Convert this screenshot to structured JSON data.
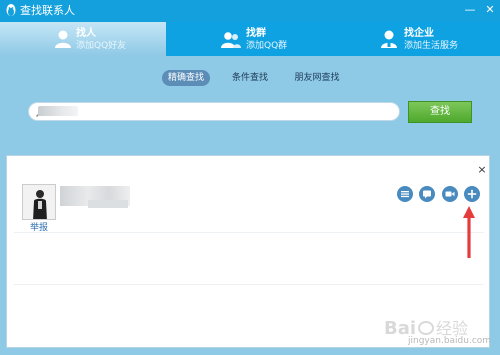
{
  "window": {
    "title": "查找联系人",
    "minimize_glyph": "—",
    "close_glyph": "✕"
  },
  "tabs": [
    {
      "label": "找人",
      "sublabel": "添加QQ好友",
      "icon": "person-icon",
      "active": true
    },
    {
      "label": "找群",
      "sublabel": "添加QQ群",
      "icon": "group-icon",
      "active": false
    },
    {
      "label": "找企业",
      "sublabel": "添加生活服务",
      "icon": "enterprise-icon",
      "active": false
    }
  ],
  "subtabs": [
    {
      "label": "精确查找",
      "active": true
    },
    {
      "label": "条件查找",
      "active": false
    },
    {
      "label": "朋友网查找",
      "active": false
    }
  ],
  "search": {
    "value": "",
    "button_label": "查找"
  },
  "results": {
    "close_glyph": "×",
    "items": [
      {
        "report_label": "举报",
        "actions": [
          "profile-icon",
          "chat-icon",
          "video-icon",
          "add-icon"
        ]
      }
    ]
  },
  "colors": {
    "titlebar": "#14a0dd",
    "tabbar": "#0ea2e3",
    "background": "#8ec9e6",
    "search_button": "#4ea92c",
    "action_icon": "#4a8bbf",
    "annotation_arrow": "#e53b3b"
  },
  "watermark": {
    "text": "jingyan.baidu.com"
  }
}
